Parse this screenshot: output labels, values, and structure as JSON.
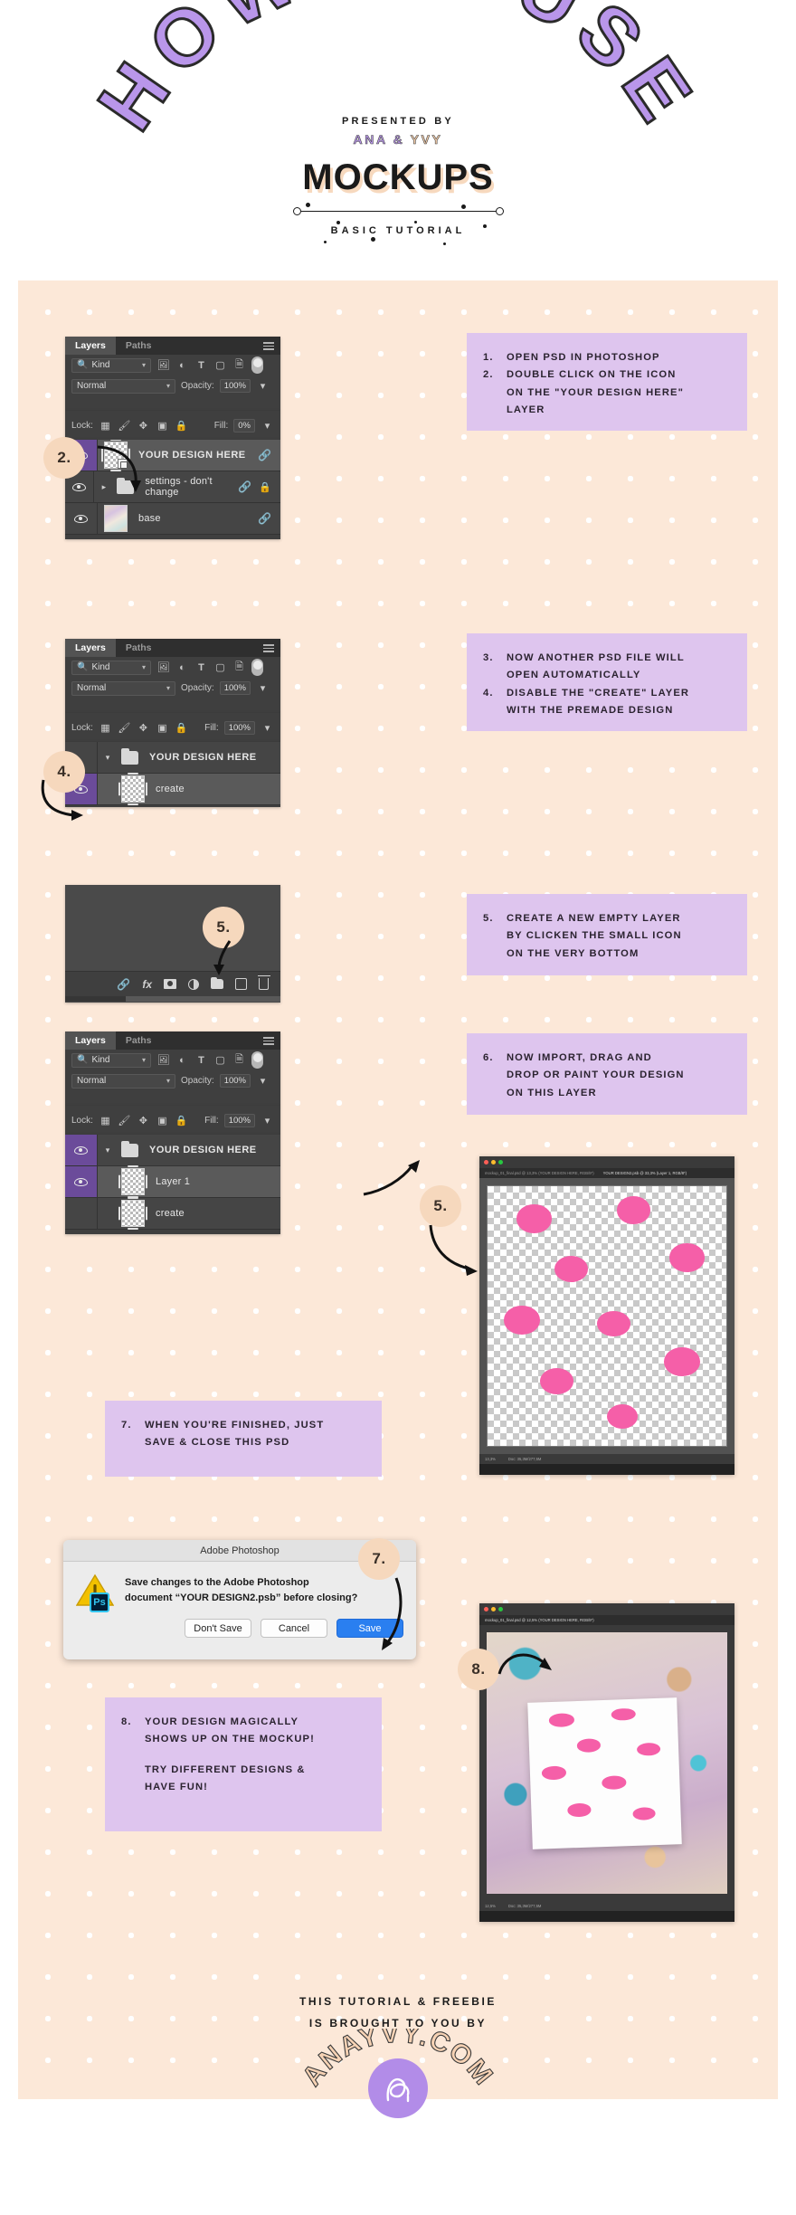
{
  "header": {
    "arch_text": "HOW TO USE",
    "presented_by": "PRESENTED BY",
    "author_1": "ANA",
    "author_amp": "&",
    "author_2": "YVY",
    "mockups": "MOCKUPS",
    "subtitle": "BASIC TUTORIAL"
  },
  "colors": {
    "peach_bg": "#fce8d8",
    "card_purple": "#dec5ee",
    "bubble_peach": "#f6d8bd",
    "accent_purple": "#b28ce8",
    "ps_highlight": "#6b4b9a",
    "dot_pink": "#f55fa8",
    "save_blue": "#2a7ff0"
  },
  "panel1": {
    "tabs": [
      "Layers",
      "Paths"
    ],
    "active_tab": "Layers",
    "filter_value": "Kind",
    "blend_mode": "Normal",
    "opacity_label": "Opacity:",
    "opacity_value": "100%",
    "lock_label": "Lock:",
    "fill_label": "Fill:",
    "fill_value": "0%",
    "layers": [
      {
        "name": "YOUR DESIGN HERE",
        "visible": true,
        "selected": true,
        "thumb": "smart-object",
        "link": true,
        "lock": false
      },
      {
        "name": "settings - don't change",
        "visible": true,
        "selected": false,
        "thumb": "folder",
        "link": true,
        "lock": true
      },
      {
        "name": "base",
        "visible": true,
        "selected": false,
        "thumb": "artwork",
        "link": true,
        "lock": false
      }
    ]
  },
  "panel2": {
    "tabs": [
      "Layers",
      "Paths"
    ],
    "active_tab": "Layers",
    "filter_value": "Kind",
    "blend_mode": "Normal",
    "opacity_label": "Opacity:",
    "opacity_value": "100%",
    "lock_label": "Lock:",
    "fill_label": "Fill:",
    "fill_value": "100%",
    "layers": [
      {
        "name": "YOUR DESIGN HERE",
        "visible": false,
        "selected": false,
        "thumb": "folder-open"
      },
      {
        "name": "create",
        "visible": true,
        "selected": true,
        "thumb": "pattern"
      }
    ]
  },
  "panel3": {
    "bottom_icons": [
      "link-icon",
      "fx-icon",
      "mask-icon",
      "adjustment-icon",
      "new-group-icon",
      "new-layer-icon",
      "delete-icon"
    ]
  },
  "panel4": {
    "tabs": [
      "Layers",
      "Paths"
    ],
    "active_tab": "Layers",
    "filter_value": "Kind",
    "blend_mode": "Normal",
    "opacity_label": "Opacity:",
    "opacity_value": "100%",
    "lock_label": "Lock:",
    "fill_label": "Fill:",
    "fill_value": "100%",
    "layers": [
      {
        "name": "YOUR DESIGN HERE",
        "visible": true,
        "selected": false,
        "thumb": "folder-open"
      },
      {
        "name": "Layer 1",
        "visible": true,
        "selected": true,
        "thumb": "empty"
      },
      {
        "name": "create",
        "visible": false,
        "selected": false,
        "thumb": "pattern"
      }
    ]
  },
  "steps": {
    "bubble_2": "2.",
    "bubble_4": "4.",
    "bubble_5a": "5.",
    "bubble_5b": "5.",
    "bubble_7": "7.",
    "bubble_8": "8."
  },
  "cards": [
    {
      "id": "card-1-2",
      "lines": [
        {
          "num": "1.",
          "txt": "OPEN PSD IN PHOTOSHOP"
        },
        {
          "num": "2.",
          "txt": "DOUBLE CLICK ON THE ICON"
        },
        {
          "num": "",
          "txt": "ON THE \"YOUR DESIGN HERE\""
        },
        {
          "num": "",
          "txt": "LAYER"
        }
      ]
    },
    {
      "id": "card-3-4",
      "lines": [
        {
          "num": "3.",
          "txt": "NOW ANOTHER PSD FILE WILL"
        },
        {
          "num": "",
          "txt": "OPEN AUTOMATICALLY"
        },
        {
          "num": "4.",
          "txt": "DISABLE THE \"CREATE\" LAYER"
        },
        {
          "num": "",
          "txt": "WITH THE PREMADE DESIGN"
        }
      ]
    },
    {
      "id": "card-5",
      "lines": [
        {
          "num": "5.",
          "txt": "CREATE A NEW EMPTY LAYER"
        },
        {
          "num": "",
          "txt": "BY CLICKEN THE SMALL ICON"
        },
        {
          "num": "",
          "txt": "ON THE VERY BOTTOM"
        }
      ]
    },
    {
      "id": "card-6",
      "lines": [
        {
          "num": "6.",
          "txt": "NOW IMPORT, DRAG AND"
        },
        {
          "num": "",
          "txt": "DROP OR PAINT YOUR DESIGN"
        },
        {
          "num": "",
          "txt": "ON THIS LAYER"
        }
      ]
    },
    {
      "id": "card-7",
      "lines": [
        {
          "num": "7.",
          "txt": "WHEN YOU'RE FINISHED, JUST"
        },
        {
          "num": "",
          "txt": "SAVE & CLOSE THIS PSD"
        }
      ]
    },
    {
      "id": "card-8",
      "lines": [
        {
          "num": "8.",
          "txt": "YOUR DESIGN MAGICALLY"
        },
        {
          "num": "",
          "txt": "SHOWS UP ON THE MOCKUP!"
        },
        {
          "num": "",
          "txt": ""
        },
        {
          "num": "",
          "txt": "TRY DIFFERENT DESIGNS &"
        },
        {
          "num": "",
          "txt": "HAVE FUN!"
        }
      ]
    }
  ],
  "dialog": {
    "title": "Adobe Photoshop",
    "message_line1": "Save changes to the Adobe Photoshop",
    "message_line2": "document “YOUR DESIGN2.psb” before closing?",
    "buttons": {
      "dont_save": "Don't Save",
      "cancel": "Cancel",
      "save": "Save"
    },
    "app_badge": "Ps"
  },
  "shot_design": {
    "titlebar_text": "mockup_01_final.psd @ 13,3% (YOUR DESIGN HERE, RGB/8*)",
    "tab_text": "YOUR DESIGN2.psb @ 33,3% (Layer 1, RGB/8*)",
    "status_left": "13,3%",
    "status_right": "Doc: 35,3M/277,5M"
  },
  "shot_mockup": {
    "titlebar_text": "mockup_01_final.psd @ 12,5% (YOUR DESIGN HERE, RGB/8*)",
    "status_left": "12,5%",
    "status_right": "Doc: 35,3M/277,5M"
  },
  "footer": {
    "line1": "THIS TUTORIAL & FREEBIE",
    "line2": "IS BROUGHT TO YOU BY",
    "brand": "ANAYVY.COM"
  }
}
